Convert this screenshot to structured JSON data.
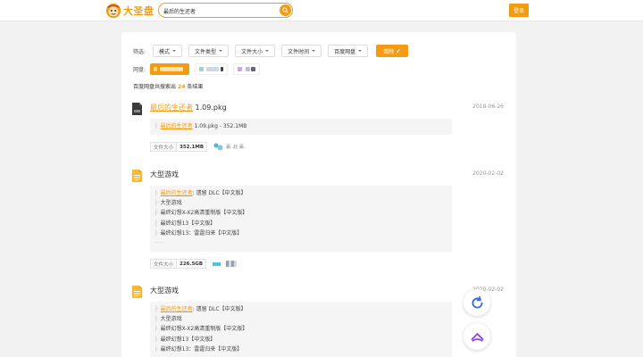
{
  "header": {
    "logo_text": "大圣盘",
    "search_value": "最后的生还者",
    "login_label": "登录"
  },
  "filters": {
    "label": "筛选:",
    "items": [
      "模式",
      "文件类型",
      "文件大小",
      "文件时间",
      "百度网盘"
    ],
    "clear_label": "清除"
  },
  "pan": {
    "label": "网盘:"
  },
  "summary": {
    "prefix": "百度网盘共搜索出",
    "count": "24",
    "suffix": "条结果"
  },
  "results": [
    {
      "title_highlight": "最后的生还者",
      "title_rest": "1.09.pkg",
      "date": "2018-06-26",
      "files": [
        {
          "highlight": "最后的生还者",
          "rest": "1.09.pkg - 352.1MB"
        }
      ],
      "size_label": "文件大小",
      "size": "352.1MB",
      "share_text": "赢..赵 赢.."
    },
    {
      "title": "大型游戏",
      "date": "2020-02-02",
      "files": [
        {
          "highlight": "最后的生还者",
          "rest": ": 遗留 DLC【中文版】"
        },
        {
          "text": "大型游戏"
        },
        {
          "text": "最终幻想X-X2高清重制版【中文版】"
        },
        {
          "text": "最终幻想13【中文版】"
        },
        {
          "text": "最终幻想13：雷霆归来【中文版】"
        }
      ],
      "more": "......",
      "size_label": "文件大小",
      "size": "226.5GB"
    },
    {
      "title": "大型游戏",
      "date": "2020-02-02",
      "files": [
        {
          "highlight": "最后的生还者",
          "rest": ": 遗留 DLC【中文版】"
        },
        {
          "text": "大型游戏"
        },
        {
          "text": "最终幻想X-X2高清重制版【中文版】"
        },
        {
          "text": "最终幻想13【中文版】"
        },
        {
          "text": "最终幻想13：雷霆归来【中文版】"
        }
      ]
    }
  ],
  "colors": {
    "accent": "#f39c12",
    "tree_bg": "#f5f5f5",
    "page_bg": "#f2f2f2"
  }
}
